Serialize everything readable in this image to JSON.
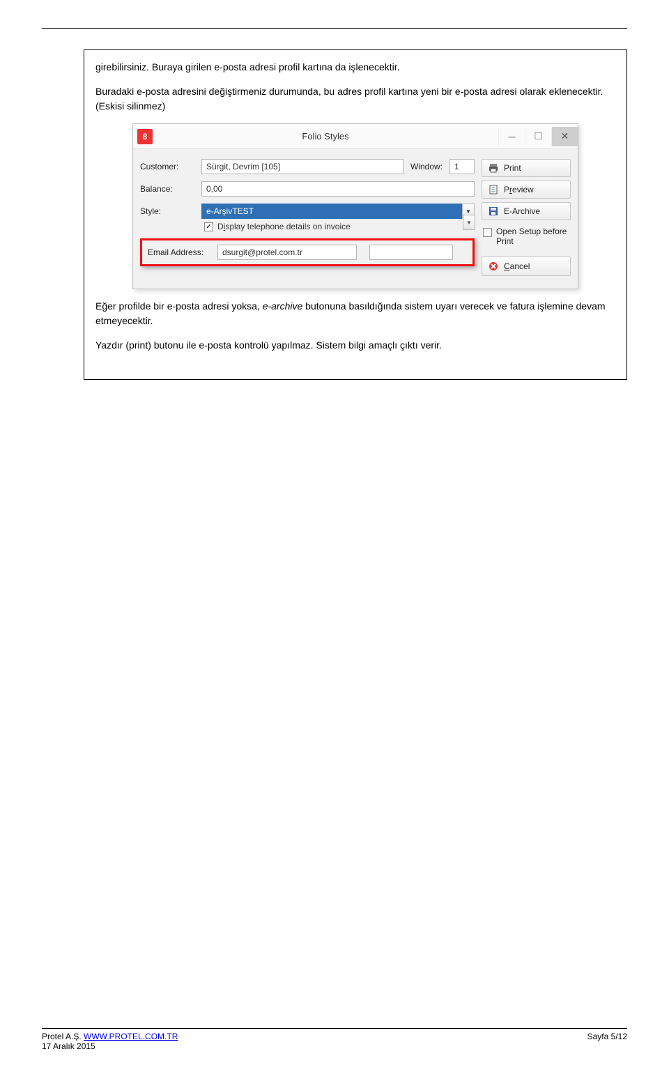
{
  "body": {
    "p1": "girebilirsiniz. Buraya girilen e-posta adresi profil kartına da işlenecektir.",
    "p2": "Buradaki e-posta adresini değiştirmeniz durumunda, bu adres profil kartına yeni bir e-posta adresi olarak eklenecektir. (Eskisi silinmez)",
    "p3a": "Eğer profilde bir e-posta adresi yoksa, ",
    "p3_italic": "e-archive",
    "p3b": " butonuna basıldığında sistem uyarı verecek ve fatura işlemine devam etmeyecektir.",
    "p4": "Yazdır (print) butonu ile e-posta kontrolü yapılmaz. Sistem bilgi amaçlı çıktı verir."
  },
  "dialog": {
    "app_icon_text": "8",
    "title": "Folio Styles",
    "labels": {
      "customer": "Customer:",
      "balance": "Balance:",
      "style": "Style:",
      "window": "Window:",
      "display_tel": "Display telephone details on invoice",
      "display_tel_underline": "i",
      "email": "Email Address:"
    },
    "values": {
      "customer": "Sürgit, Devrim [105]",
      "balance": "0,00",
      "style": "e-ArşivTEST",
      "window": "1",
      "email": "dsurgit@protel.com.tr"
    },
    "buttons": {
      "print": "Print",
      "preview": "Preview",
      "preview_underline": "r",
      "earchive": "E-Archive",
      "opensetup": "Open Setup before Print",
      "cancel": "Cancel",
      "cancel_underline": "C"
    }
  },
  "footer": {
    "company": "Protel A.Ş. ",
    "link": "WWW.PROTEL.COM.TR",
    "date": "17 Aralık 2015",
    "page": "Sayfa 5/12"
  }
}
